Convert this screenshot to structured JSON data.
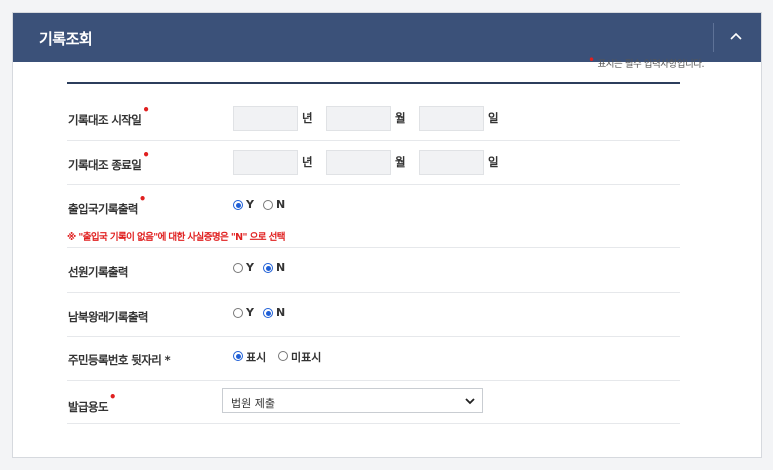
{
  "header": {
    "title": "기록조회"
  },
  "required_note": "표시는 필수 입력사항입니다.",
  "rows": {
    "start_date": {
      "label": "기록대조 시작일",
      "unit_year": "년",
      "unit_month": "월",
      "unit_day": "일"
    },
    "end_date": {
      "label": "기록대조 종료일",
      "unit_year": "년",
      "unit_month": "월",
      "unit_day": "일"
    },
    "immigration": {
      "label": "출입국기록출력",
      "opt_y": "Y",
      "opt_n": "N",
      "selected": "Y"
    },
    "warning": "※ \"출입국 기록이 없음\"에 대한 사실증명은 \"N\" 으로 선택",
    "crew": {
      "label": "선원기록출력",
      "opt_y": "Y",
      "opt_n": "N",
      "selected": "N"
    },
    "inter_korea": {
      "label": "남북왕래기록출력",
      "opt_y": "Y",
      "opt_n": "N",
      "selected": "N"
    },
    "resident_no": {
      "label": "주민등록번호 뒷자리 *",
      "opt_show": "표시",
      "opt_hide": "미표시",
      "selected": "표시"
    },
    "purpose": {
      "label": "발급용도",
      "selected": "법원 제출"
    }
  },
  "colors": {
    "header_bg": "#3b5179",
    "required": "#e02020",
    "radio_on": "#1f5fd6"
  }
}
